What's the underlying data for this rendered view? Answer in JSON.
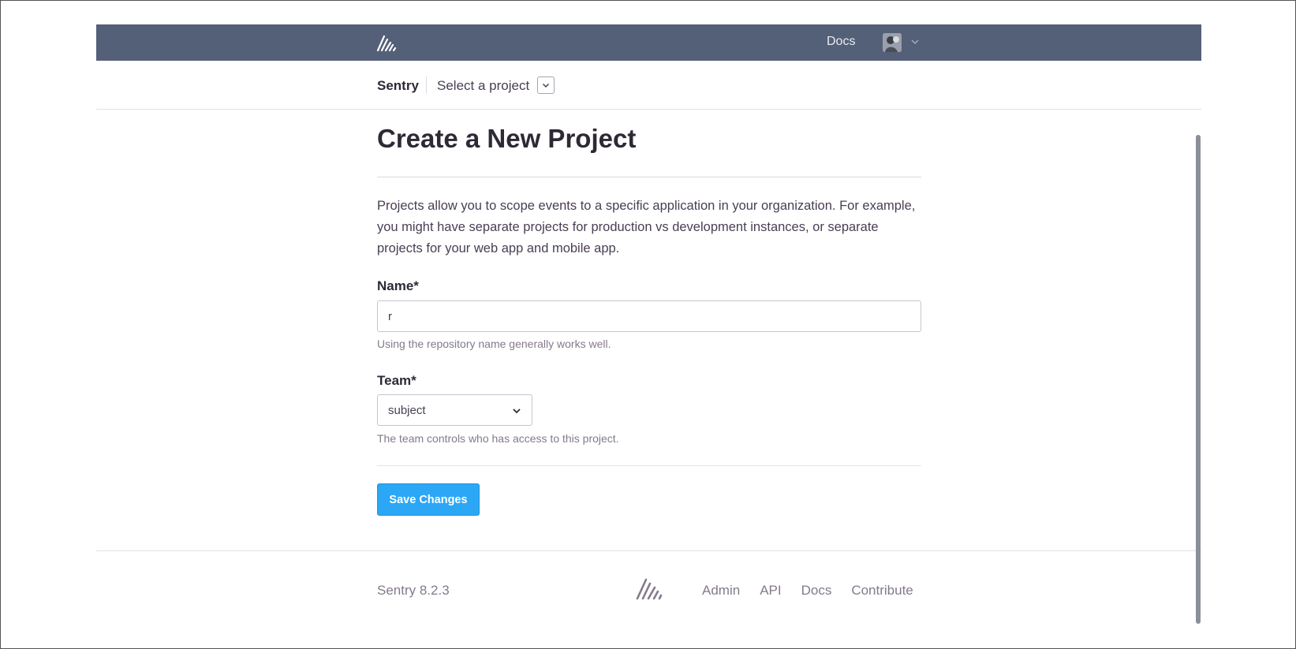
{
  "topbar": {
    "logo_icon": "sentry-logo-icon",
    "docs_label": "Docs",
    "avatar_icon": "user-avatar",
    "chevron_icon": "chevron-down-icon",
    "background_color": "#545f78"
  },
  "breadcrumb": {
    "org_name": "Sentry",
    "project_select_label": "Select a project",
    "project_select_icon": "chevron-down-icon"
  },
  "main": {
    "title": "Create a New Project",
    "intro": "Projects allow you to scope events to a specific application in your organization. For example, you might have separate projects for production vs development instances, or separate projects for your web app and mobile app.",
    "name_field": {
      "label": "Name*",
      "value": "r",
      "help": "Using the repository name generally works well."
    },
    "team_field": {
      "label": "Team*",
      "value": "subject",
      "help": "The team controls who has access to this project."
    },
    "save_label": "Save Changes",
    "accent_color": "#2ba7f5"
  },
  "footer": {
    "version": "Sentry 8.2.3",
    "logo_icon": "sentry-logo-icon",
    "links": [
      "Admin",
      "API",
      "Docs",
      "Contribute"
    ]
  }
}
